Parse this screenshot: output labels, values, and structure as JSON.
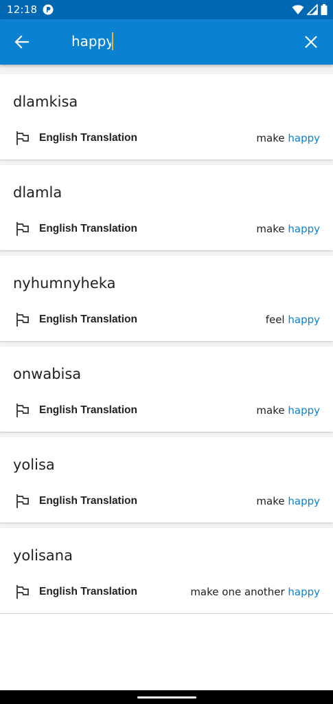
{
  "status_bar": {
    "time": "12:18",
    "icons": [
      "app-notification-icon",
      "wifi-icon",
      "signal-icon",
      "battery-icon"
    ]
  },
  "app_bar": {
    "back_icon": "arrow-left-icon",
    "search_value": "happy",
    "clear_icon": "close-icon",
    "background": "#0b82d1",
    "caret_color": "#f6b32a"
  },
  "results": [
    {
      "word": "dlamkisa",
      "label": "English Translation",
      "pre": "make ",
      "match": "happy"
    },
    {
      "word": "dlamla",
      "label": "English Translation",
      "pre": "make ",
      "match": "happy"
    },
    {
      "word": "nyhumnyheka",
      "label": "English Translation",
      "pre": "feel ",
      "match": "happy"
    },
    {
      "word": "onwabisa",
      "label": "English Translation",
      "pre": "make ",
      "match": "happy"
    },
    {
      "word": "yolisa",
      "label": "English Translation",
      "pre": "make ",
      "match": "happy"
    },
    {
      "word": "yolisana",
      "label": "English Translation",
      "pre": "make one another ",
      "match": "happy"
    }
  ],
  "highlight_color": "#0b82d1"
}
